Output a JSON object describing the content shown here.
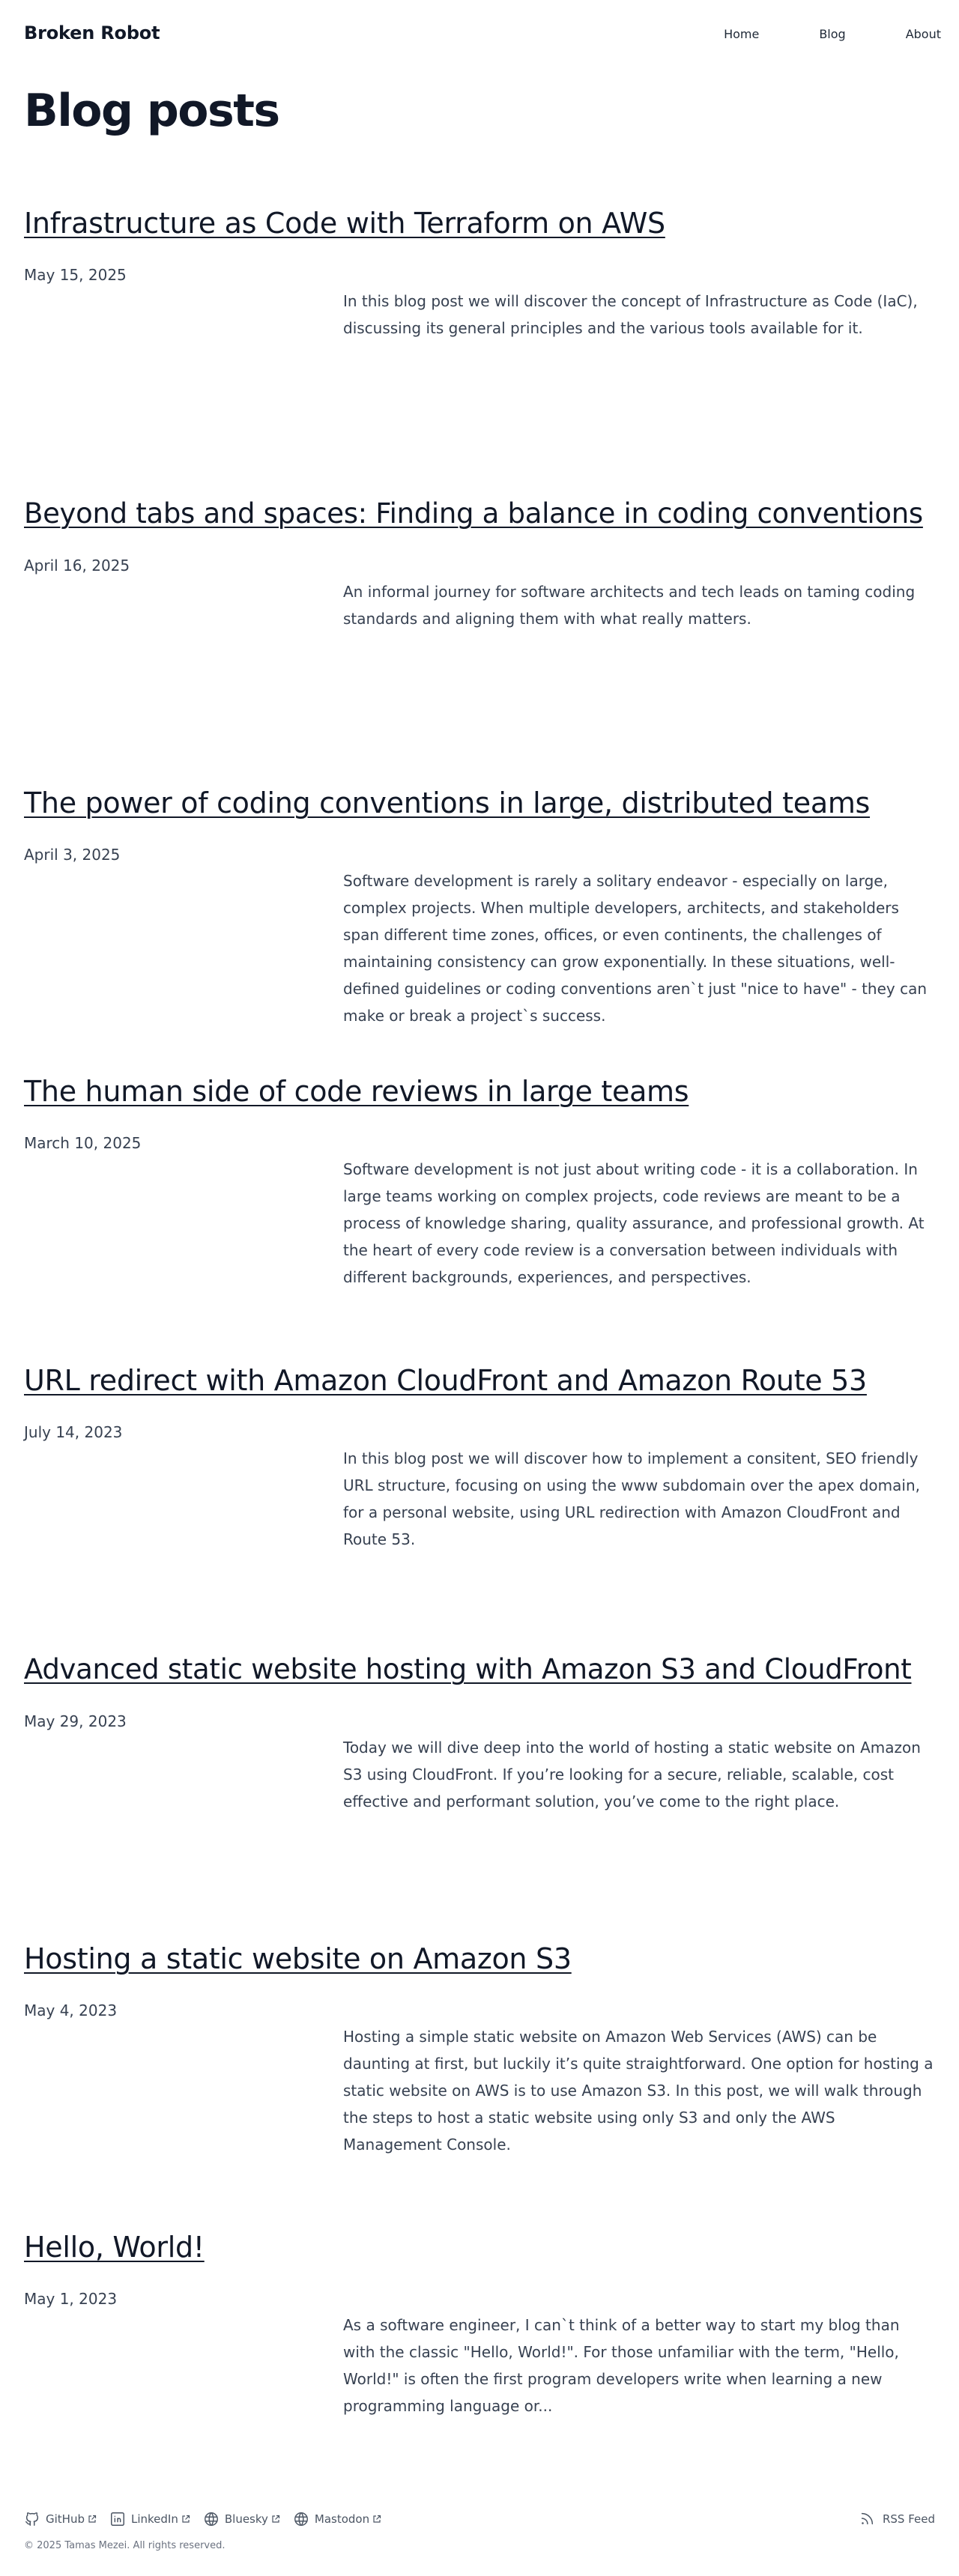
{
  "site": {
    "brand": "Broken Robot"
  },
  "nav": {
    "items": [
      "Home",
      "Blog",
      "About"
    ]
  },
  "page": {
    "title": "Blog posts"
  },
  "posts": [
    {
      "title": "Infrastructure as Code with Terraform on AWS",
      "date": "May 15, 2025",
      "excerpt": "In this blog post we will discover the concept of Infrastructure as Code (IaC), discussing its general principles and the various tools available for it."
    },
    {
      "title": "Beyond tabs and spaces: Finding a balance in coding conventions",
      "date": "April 16, 2025",
      "excerpt": "An informal journey for software architects and tech leads on taming coding standards and aligning them with what really matters."
    },
    {
      "title": "The power of coding conventions in large, distributed teams",
      "date": "April 3, 2025",
      "excerpt": "Software development is rarely a solitary endeavor - especially on large, complex projects. When multiple developers, architects, and stakeholders span different time zones, offices, or even continents, the challenges of maintaining consistency can grow exponentially. In these situations, well-defined guidelines or coding conventions aren`t just \"nice to have\" - they can make or break a project`s success."
    },
    {
      "title": "The human side of code reviews in large teams",
      "date": "March 10, 2025",
      "excerpt": "Software development is not just about writing code - it is a collaboration. In large teams working on complex projects, code reviews are meant to be a process of knowledge sharing, quality assurance, and professional growth. At the heart of every code review is a conversation between individuals with different backgrounds, experiences, and perspectives."
    },
    {
      "title": "URL redirect with Amazon CloudFront and Amazon Route 53",
      "date": "July 14, 2023",
      "excerpt": "In this blog post we will discover how to implement a consitent, SEO friendly URL structure, focusing on using the www subdomain over the apex domain, for a personal website, using URL redirection with Amazon CloudFront and Route 53."
    },
    {
      "title": "Advanced static website hosting with Amazon S3 and CloudFront",
      "date": "May 29, 2023",
      "excerpt": "Today we will dive deep into the world of hosting a static website on Amazon S3 using CloudFront. If you’re looking for a secure, reliable, scalable, cost effective and performant solution, you’ve come to the right place."
    },
    {
      "title": "Hosting a static website on Amazon S3",
      "date": "May 4, 2023",
      "excerpt": "Hosting a simple static website on Amazon Web Services (AWS) can be daunting at first, but luckily it’s quite straightforward. One option for hosting a static website on AWS is to use Amazon S3. In this post, we will walk through the steps to host a static website using only S3 and only the AWS Management Console."
    },
    {
      "title": "Hello, World!",
      "date": "May 1, 2023",
      "excerpt": "As a software engineer, I can`t think of a better way to start my blog than with the classic \"Hello, World!\". For those unfamiliar with the term, \"Hello, World!\" is often the first program developers write when learning a new programming language or..."
    }
  ],
  "footer": {
    "social": [
      {
        "label": "GitHub",
        "icon": "github-icon"
      },
      {
        "label": "LinkedIn",
        "icon": "linkedin-icon"
      },
      {
        "label": "Bluesky",
        "icon": "globe-icon"
      },
      {
        "label": "Mastodon",
        "icon": "globe-icon"
      }
    ],
    "rss": "RSS Feed",
    "copyright": "© 2025 Tamas Mezei. All rights reserved."
  }
}
